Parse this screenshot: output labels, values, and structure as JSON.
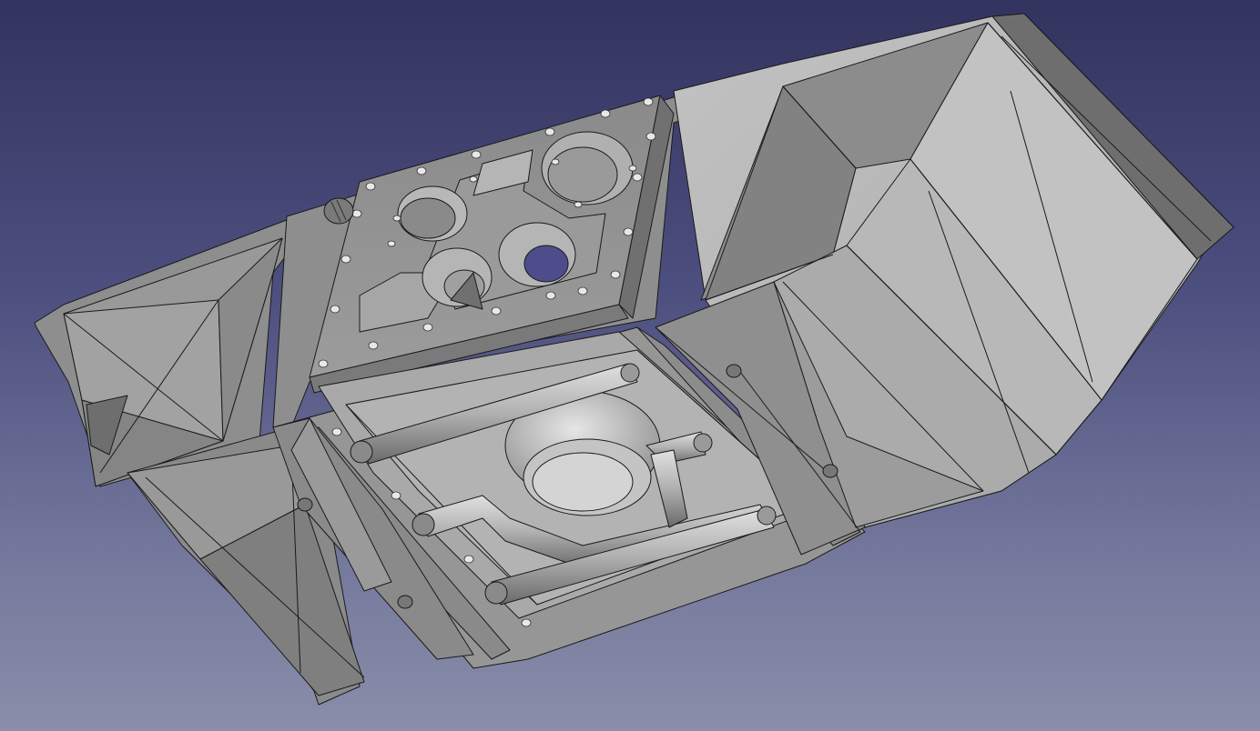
{
  "viewport": {
    "background_top": "#33335f",
    "background_bottom": "#8a8eaa"
  },
  "model": {
    "face_light": "#bdbdbd",
    "face_mid": "#9d9d9d",
    "face_dark": "#7e7e7e",
    "face_shadow": "#5e5e5e",
    "edge_color": "#1a1a1a",
    "bore_color": "#4d4d8c"
  }
}
